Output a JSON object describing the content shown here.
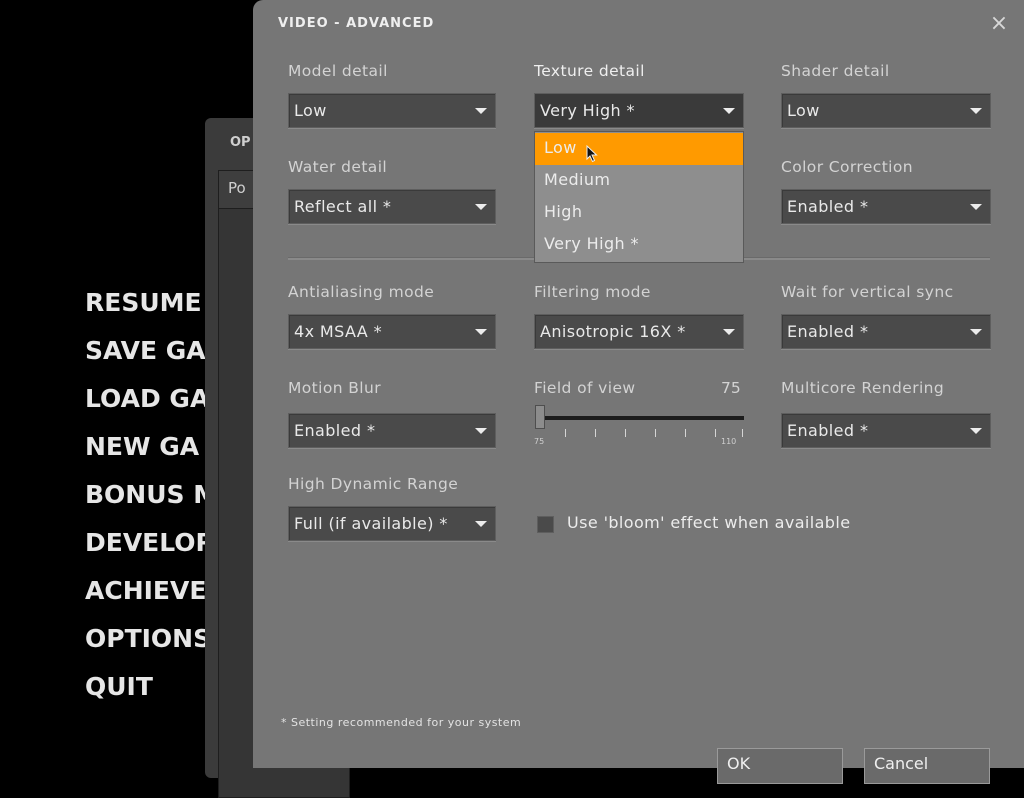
{
  "main_menu": {
    "items": [
      "RESUME",
      "SAVE GA",
      "LOAD GA",
      "NEW GA",
      "BONUS M",
      "DEVELOP",
      "ACHIEVE",
      "OPTIONS",
      "QUIT"
    ]
  },
  "options_dialog": {
    "title": "OP",
    "tab": "Po"
  },
  "dialog": {
    "title": "VIDEO - ADVANCED",
    "close_icon": "×",
    "model_detail": {
      "label": "Model detail",
      "value": "Low"
    },
    "texture_detail": {
      "label": "Texture detail",
      "value": "Very High *"
    },
    "shader_detail": {
      "label": "Shader detail",
      "value": "Low"
    },
    "water_detail": {
      "label": "Water detail",
      "value": "Reflect all *"
    },
    "color_correction": {
      "label": "Color Correction",
      "value": "Enabled *"
    },
    "antialiasing": {
      "label": "Antialiasing mode",
      "value": "4x MSAA *"
    },
    "filtering": {
      "label": "Filtering mode",
      "value": "Anisotropic 16X *"
    },
    "vsync": {
      "label": "Wait for vertical sync",
      "value": "Enabled *"
    },
    "motion_blur": {
      "label": "Motion Blur",
      "value": "Enabled *"
    },
    "fov": {
      "label": "Field of view",
      "value": "75",
      "min": "75",
      "max": "110"
    },
    "multicore": {
      "label": "Multicore Rendering",
      "value": "Enabled *"
    },
    "hdr": {
      "label": "High Dynamic Range",
      "value": "Full (if available) *"
    },
    "bloom": {
      "label": "Use 'bloom' effect when available",
      "checked": false
    },
    "texture_dropdown": {
      "options": [
        "Low",
        "Medium",
        "High",
        "Very High *"
      ],
      "highlighted": "Low"
    },
    "footnote": "* Setting recommended for your system",
    "ok_label": "OK",
    "cancel_label": "Cancel"
  },
  "colors": {
    "dialog_bg": "#767676",
    "highlight": "#ff9a00",
    "field_bg": "#4a4a4a"
  }
}
